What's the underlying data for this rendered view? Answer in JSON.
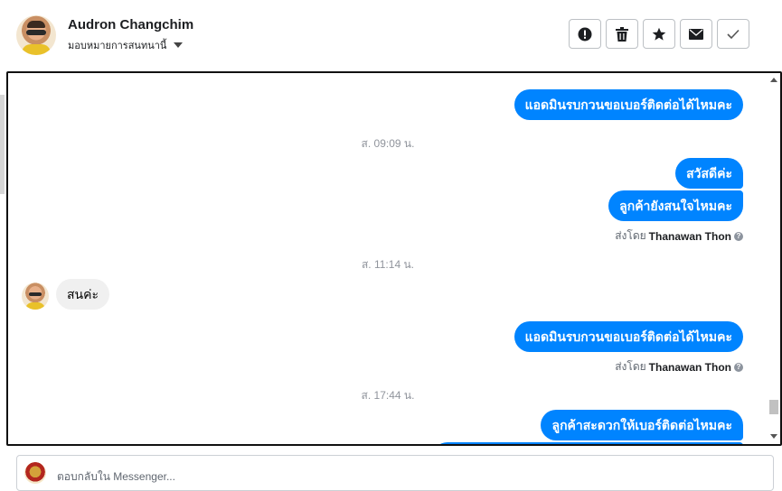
{
  "header": {
    "contact_name": "Audron Changchim",
    "assign_label": "มอบหมายการสนทนานี้",
    "actions": [
      {
        "name": "spam",
        "icon": "exclamation-icon"
      },
      {
        "name": "delete",
        "icon": "trash-icon"
      },
      {
        "name": "star",
        "icon": "star-icon"
      },
      {
        "name": "mark-unread",
        "icon": "envelope-icon"
      },
      {
        "name": "done",
        "icon": "check-icon"
      }
    ]
  },
  "messages": {
    "m1": "แอดมินรบกวนขอเบอร์ติดต่อได้ไหมคะ",
    "ts1": "ส. 09:09 น.",
    "m2": "สวัสดีค่ะ",
    "m3": "ลูกค้ายังสนใจไหมคะ",
    "sent_by_prefix_1": "ส่งโดย",
    "sent_by_name_1": "Thanawan Thon",
    "ts2": "ส. 11:14 น.",
    "m4": "สนค่ะ",
    "m5": "แอดมินรบกวนขอเบอร์ติดต่อได้ไหมคะ",
    "sent_by_prefix_2": "ส่งโดย",
    "sent_by_name_2": "Thanawan Thon",
    "ts3": "ส. 17:44 น.",
    "m6": "ลูกค้าสะดวกให้เบอร์ติดต่อไหมคะ"
  },
  "reply": {
    "placeholder": "ตอบกลับใน Messenger..."
  },
  "colors": {
    "outgoing_bubble": "#0084ff",
    "incoming_bubble": "#f0f0f0",
    "timestamp": "#90949c"
  }
}
